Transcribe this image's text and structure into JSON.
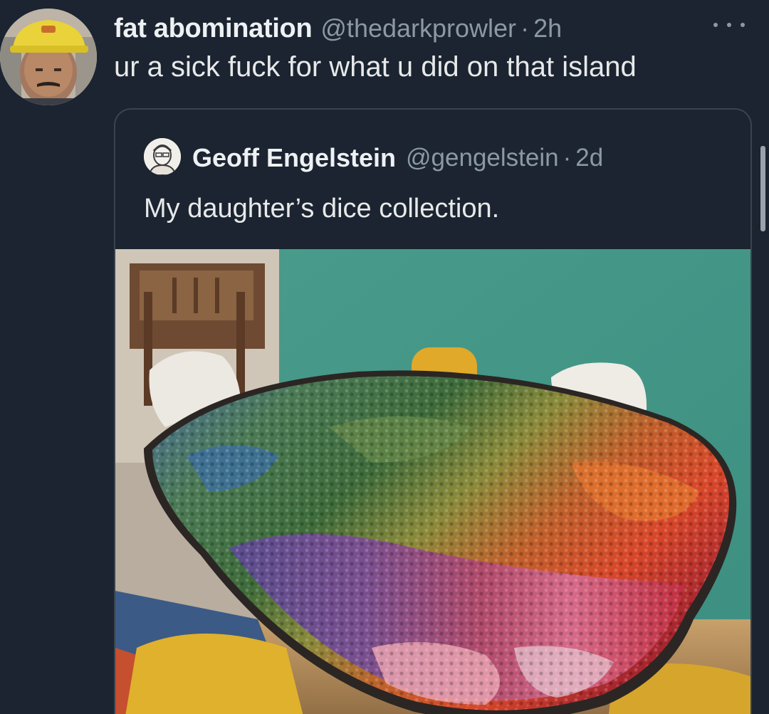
{
  "tweet": {
    "display_name": "fat abomination",
    "handle": "@thedarkprowler",
    "separator": "·",
    "time": "2h",
    "text": "ur a sick fuck for what u did on that island",
    "more_icon": "more-horizontal-icon"
  },
  "quoted_tweet": {
    "display_name": "Geoff Engelstein",
    "handle": "@gengelstein",
    "separator": "·",
    "time": "2d",
    "text": "My daughter’s dice collection."
  },
  "colors": {
    "background": "#1b2430",
    "text": "#e7e9ea",
    "secondary_text": "#8b98a5",
    "border": "#38444d",
    "wall": "#4fa894"
  }
}
